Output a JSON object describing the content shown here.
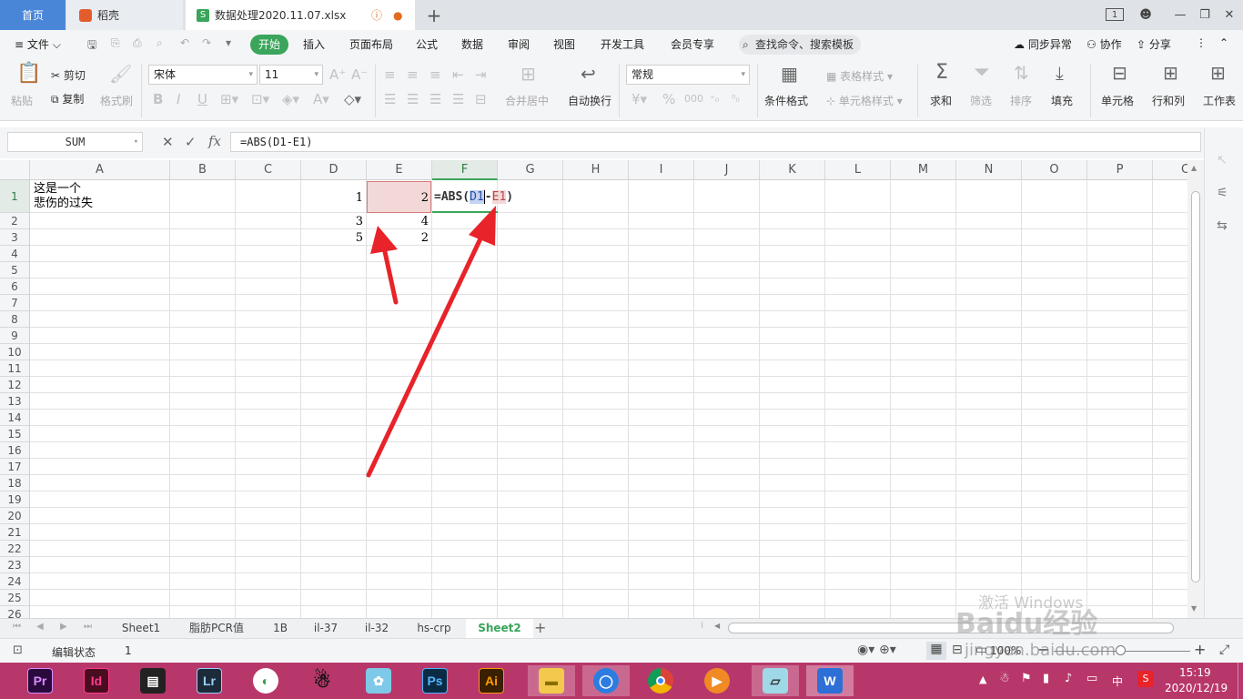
{
  "tabs": {
    "home": "首页",
    "daoke": "稻壳",
    "file": "数据处理2020.11.07.xlsx",
    "add": "+"
  },
  "window": {
    "badge": "1"
  },
  "menu": {
    "file": "文件",
    "items": [
      "开始",
      "插入",
      "页面布局",
      "公式",
      "数据",
      "审阅",
      "视图",
      "开发工具",
      "会员专享"
    ],
    "search": "查找命令、搜索模板",
    "sync": "同步异常",
    "collab": "协作",
    "share": "分享"
  },
  "ribbon": {
    "paste": "粘贴",
    "cut": "剪切",
    "copy": "复制",
    "format_painter": "格式刷",
    "font": "宋体",
    "size": "11",
    "merge": "合并居中",
    "wrap": "自动换行",
    "number_format": "常规",
    "cond_format": "条件格式",
    "table_style": "表格样式",
    "cell_style": "单元格样式",
    "sum": "求和",
    "filter": "筛选",
    "sort": "排序",
    "fill": "填充",
    "cell": "单元格",
    "row_col": "行和列",
    "sheet": "工作表"
  },
  "formula_bar": {
    "name_box": "SUM",
    "fx": "fx",
    "formula": "=ABS(D1-E1)"
  },
  "grid": {
    "columns": [
      "A",
      "B",
      "C",
      "D",
      "E",
      "F",
      "G",
      "H",
      "I",
      "J",
      "K",
      "L",
      "M",
      "N",
      "O",
      "P",
      "C"
    ],
    "rows": [
      "1",
      "2",
      "3",
      "4",
      "5",
      "6",
      "7",
      "8",
      "9",
      "10",
      "11",
      "12",
      "13",
      "14",
      "15",
      "16",
      "17",
      "18",
      "19",
      "20",
      "21",
      "22",
      "23",
      "24",
      "25",
      "26"
    ],
    "A1_line1": "这是一个",
    "A1_line2": "悲伤的过失",
    "D1": "1",
    "E1": "2",
    "D2": "3",
    "E2": "4",
    "D3": "5",
    "E3": "2",
    "F1_prefix": "=ABS(",
    "F1_ref1": "D1",
    "F1_op": "-",
    "F1_ref2": "E1",
    "F1_suffix": ")"
  },
  "sheets": [
    "Sheet1",
    "脂肪PCR值",
    "1B",
    "il-37",
    "il-32",
    "hs-crp",
    "Sheet2"
  ],
  "active_sheet": "Sheet2",
  "status": {
    "mode": "编辑状态",
    "count": "1",
    "zoom": "100%"
  },
  "taskbar": {
    "apps": [
      "Pr",
      "Id",
      "Lr",
      "Ps",
      "Ai"
    ],
    "ime": "中",
    "time": "15:19",
    "date": "2020/12/19"
  },
  "watermark": {
    "activate": "激活 Windows",
    "brand": "Baidu经验",
    "url": "jingyan.baidu.com"
  },
  "colors": {
    "accent_green": "#3aa55b",
    "ref_blue": "#c5d3f2",
    "ref_red": "#f3d8d8",
    "taskbar": "#b8376b",
    "arrow": "#e8232a"
  }
}
